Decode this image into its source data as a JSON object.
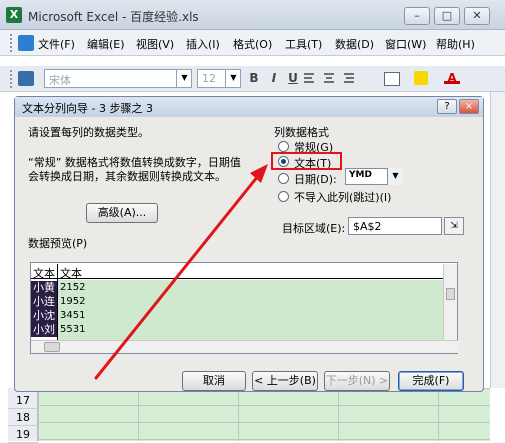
{
  "window": {
    "title": "Microsoft Excel - 百度经验.xls",
    "app_icon_label": "X"
  },
  "menu": [
    "文件(F)",
    "编辑(E)",
    "视图(V)",
    "插入(I)",
    "格式(O)",
    "工具(T)",
    "数据(D)",
    "窗口(W)",
    "帮助(H)"
  ],
  "toolbar": {
    "font": "宋体",
    "size": "12",
    "bold": "B",
    "italic": "I",
    "underline": "U",
    "font_color_label": "A"
  },
  "dialog": {
    "title": "文本分列向导 - 3 步骤之 3",
    "help_label": "?",
    "close_label": "×",
    "instruction": "请设置每列的数据类型。",
    "note_line1": "“常规” 数据格式将数值转换成数字，日期值",
    "note_line2": "会转换成日期，其余数据则转换成文本。",
    "advanced_label": "高级(A)...",
    "group_label": "列数据格式",
    "options": [
      "常规(G)",
      "文本(T)",
      "日期(D):",
      "不导入此列(跳过)(I)"
    ],
    "selected_option": "文本(T)",
    "date_format": "YMD",
    "destination_label": "目标区域(E):",
    "destination_value": "$A$2",
    "preview_label": "数据预览(P)",
    "preview": {
      "headers": [
        "文本",
        "文本"
      ],
      "rows": [
        [
          "小黄",
          "2152"
        ],
        [
          "小连",
          "1952"
        ],
        [
          "小沈",
          "3451"
        ],
        [
          "小刘",
          "5531"
        ]
      ]
    },
    "buttons": {
      "cancel": "取消",
      "back": "< 上一步(B)",
      "next": "下一步(N) >",
      "finish": "完成(F)"
    }
  },
  "sheet": {
    "rows": [
      "17",
      "18",
      "19"
    ]
  },
  "colors": {
    "highlight": "#e0141a",
    "preview_fill": "#cfe9cf",
    "name_fill": "#2b1e45"
  }
}
